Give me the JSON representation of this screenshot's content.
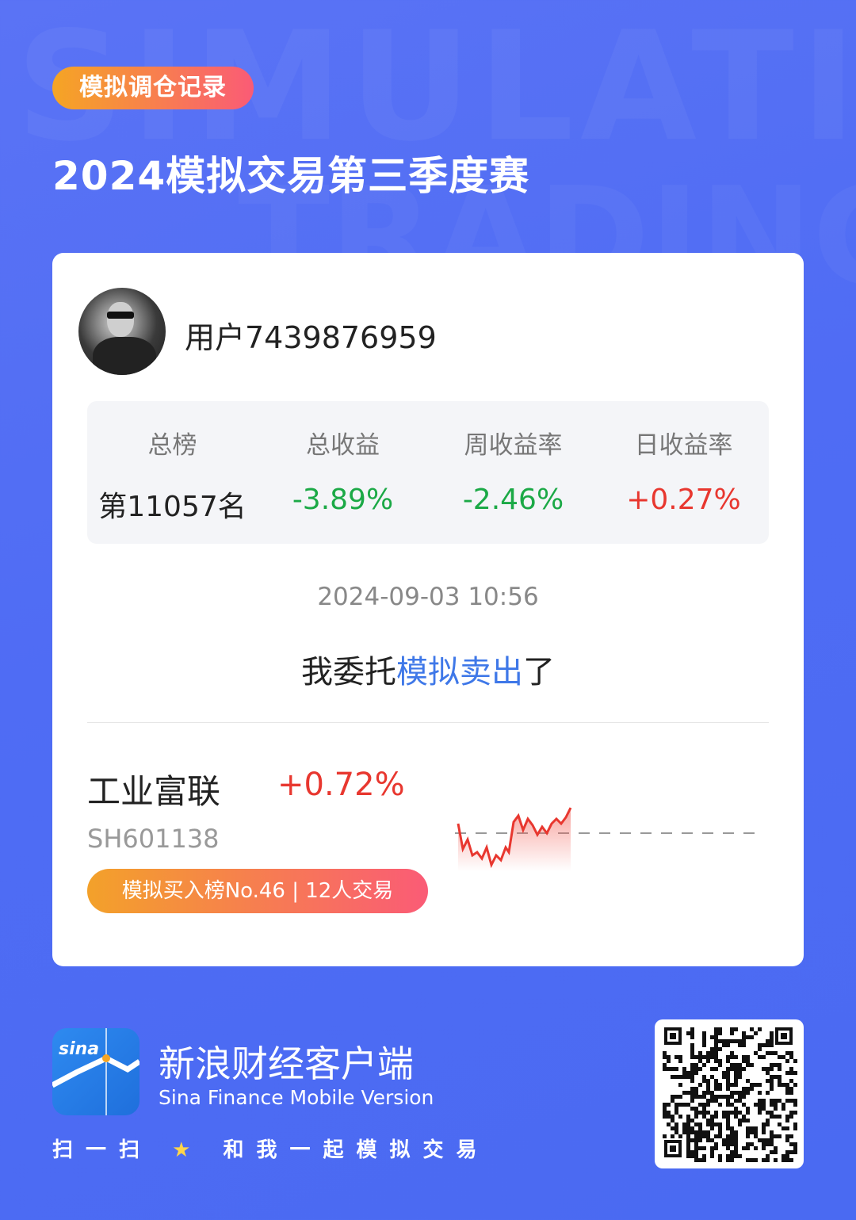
{
  "header": {
    "tag": "模拟调仓记录",
    "title": "2024模拟交易第三季度赛"
  },
  "user": {
    "name": "用户7439876959"
  },
  "stats": [
    {
      "label": "总榜",
      "value": "第11057名"
    },
    {
      "label": "总收益",
      "value": "-3.89%"
    },
    {
      "label": "周收益率",
      "value": "-2.46%"
    },
    {
      "label": "日收益率",
      "value": "+0.27%"
    }
  ],
  "trade": {
    "datetime": "2024-09-03 10:56",
    "action_prefix": "我委托",
    "action_highlight": "模拟卖出",
    "action_suffix": "了"
  },
  "stock": {
    "name": "工业富联",
    "change": "+0.72%",
    "code": "SH601138",
    "rank_badge": "模拟买入榜No.46 | 12人交易"
  },
  "footer": {
    "app_name": "新浪财经客户端",
    "app_sub": "Sina Finance Mobile Version",
    "logo_text": "sina",
    "scan_prefix": "扫一扫",
    "scan_suffix": "和我一起模拟交易"
  },
  "colors": {
    "negative": "#1ba946",
    "positive": "#e8372f",
    "highlight": "#3f78e8"
  }
}
